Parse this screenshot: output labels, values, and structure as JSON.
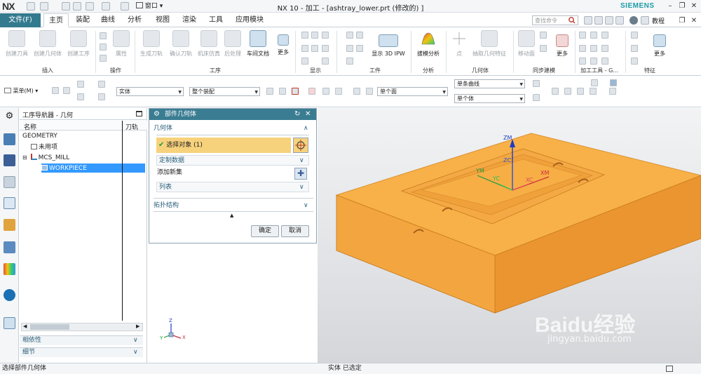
{
  "titlebar": {
    "logo": "NX",
    "window_title": "NX 10 - 加工 - [ashtray_lower.prt  (修改的) ]",
    "window_menu_label": "窗口",
    "brand": "SIEMENS"
  },
  "menubar": {
    "file_label": "文件(F)",
    "tabs": [
      "主页",
      "装配",
      "曲线",
      "分析",
      "视图",
      "渲染",
      "工具",
      "应用模块"
    ],
    "active_tab": "主页",
    "search_placeholder": "查找命令",
    "help_label": "教程"
  },
  "ribbon": {
    "buttons": [
      {
        "label": "创建刀具",
        "enabled": false
      },
      {
        "label": "创建几何体",
        "enabled": false
      },
      {
        "label": "创建工序",
        "enabled": false
      },
      {
        "label": "属性",
        "enabled": false
      },
      {
        "label": "生成刀轨",
        "enabled": false
      },
      {
        "label": "确认刀轨",
        "enabled": false
      },
      {
        "label": "机床仿真",
        "enabled": false
      },
      {
        "label": "后处理",
        "enabled": false
      },
      {
        "label": "车间文档",
        "enabled": true
      },
      {
        "label": "更多",
        "enabled": true
      },
      {
        "label": "显示 3D IPW",
        "enabled": true
      },
      {
        "label": "拔模分析",
        "enabled": true
      },
      {
        "label": "点",
        "enabled": false
      },
      {
        "label": "抽取几何特征",
        "enabled": false
      },
      {
        "label": "移动面",
        "enabled": false
      },
      {
        "label": "更多",
        "enabled": true
      },
      {
        "label": "更多",
        "enabled": true
      }
    ],
    "groups": [
      "插入",
      "操作",
      "工序",
      "显示",
      "工件",
      "分析",
      "几何体",
      "同步建模",
      "加工工具 - G...",
      "特征"
    ]
  },
  "toolbar2": {
    "menu_label": "菜单(M)",
    "filter_type": "实体",
    "filter_scope": "整个装配",
    "face_rule": "单个面",
    "curve_rule": "单条曲线",
    "body_rule": "单个体"
  },
  "navigator": {
    "title": "工序导航器 - 几何",
    "col_name": "名称",
    "col_toolpath": "刀轨",
    "rows": [
      {
        "label": "GEOMETRY",
        "selected": false
      },
      {
        "label": "未用项",
        "selected": false
      },
      {
        "label": "MCS_MILL",
        "selected": false
      },
      {
        "label": "WORKPIECE",
        "selected": true
      }
    ],
    "sections": [
      "相依性",
      "细节"
    ]
  },
  "dialog": {
    "title": "部件几何体",
    "section_geometry": "几何体",
    "select_object": "选择对象 (1)",
    "custom_data": "定制数据",
    "add_new_set": "添加新集",
    "list_label": "列表",
    "section_topology": "拓扑结构",
    "ok_label": "确定",
    "cancel_label": "取消"
  },
  "viewport": {
    "axis_labels": [
      "ZM",
      "ZC",
      "YM",
      "YC",
      "XC",
      "XM"
    ],
    "triad_labels": [
      "Z",
      "Y",
      "X"
    ],
    "part_color": "#f5a53c",
    "watermark_main": "Baidu经验",
    "watermark_url": "jingyan.baidu.com"
  },
  "status": {
    "left_text": "选择部件几何体",
    "center_text": "实体 已选定"
  },
  "colors": {
    "accent": "#337a8e",
    "selection": "#3399ff",
    "highlight_row": "#f7d27c"
  }
}
